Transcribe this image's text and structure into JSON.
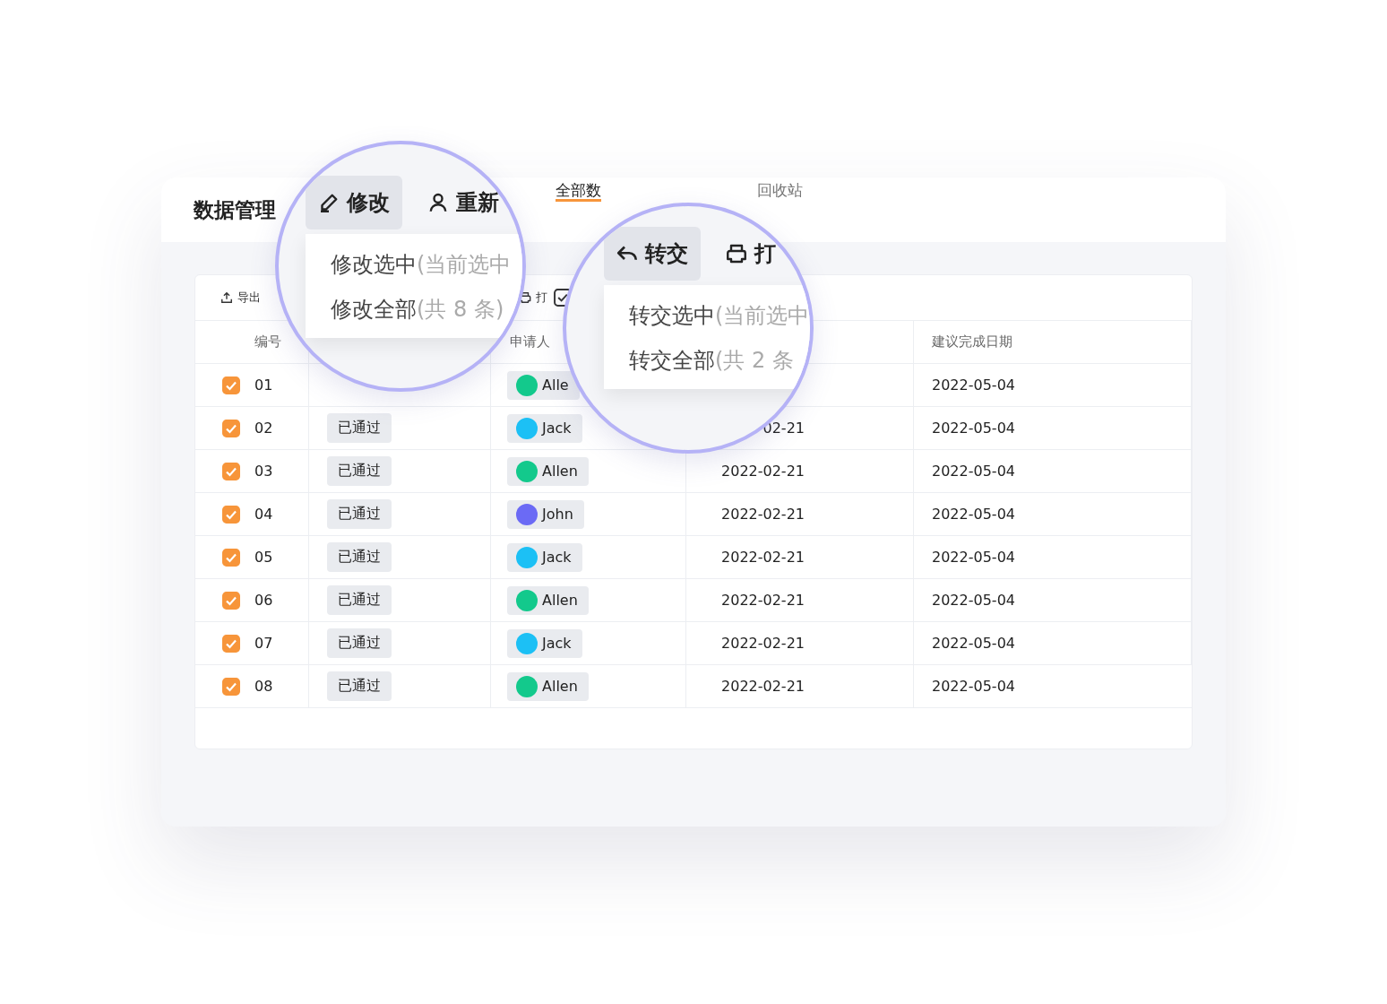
{
  "header": {
    "title": "数据管理",
    "tabs": [
      {
        "label": "全部数",
        "selected": true
      },
      {
        "label": "回收站",
        "selected": false
      }
    ]
  },
  "toolbar": [
    {
      "kind": "export",
      "label": "导出"
    },
    {
      "kind": "print",
      "label": "打"
    },
    {
      "kind": "check"
    }
  ],
  "table": {
    "headers": {
      "id": "编号",
      "applicant": "申请人",
      "due": "建议完成日期"
    },
    "rows": [
      {
        "id": "01",
        "checked": true,
        "applicant": {
          "name": "Alle",
          "color": "#13c98c"
        },
        "due": "2022-05-04"
      },
      {
        "id": "02",
        "checked": true,
        "status": "已通过",
        "applicant": {
          "name": "Jack",
          "color": "#1cc0f5"
        },
        "submitted": "02-21",
        "due": "2022-05-04"
      },
      {
        "id": "03",
        "checked": true,
        "status": "已通过",
        "applicant": {
          "name": "Allen",
          "color": "#13c98c"
        },
        "submitted": "2022-02-21",
        "due": "2022-05-04"
      },
      {
        "id": "04",
        "checked": true,
        "status": "已通过",
        "applicant": {
          "name": "John",
          "color": "#6b6af5"
        },
        "submitted": "2022-02-21",
        "due": "2022-05-04"
      },
      {
        "id": "05",
        "checked": true,
        "status": "已通过",
        "applicant": {
          "name": "Jack",
          "color": "#1cc0f5"
        },
        "submitted": "2022-02-21",
        "due": "2022-05-04"
      },
      {
        "id": "06",
        "checked": true,
        "status": "已通过",
        "applicant": {
          "name": "Allen",
          "color": "#13c98c"
        },
        "submitted": "2022-02-21",
        "due": "2022-05-04"
      },
      {
        "id": "07",
        "checked": true,
        "status": "已通过",
        "applicant": {
          "name": "Jack",
          "color": "#1cc0f5"
        },
        "submitted": "2022-02-21",
        "due": "2022-05-04"
      },
      {
        "id": "08",
        "checked": true,
        "status": "已通过",
        "applicant": {
          "name": "Allen",
          "color": "#13c98c"
        },
        "submitted": "2022-02-21",
        "due": "2022-05-04"
      }
    ]
  },
  "magnifiers": [
    {
      "buttons": [
        {
          "kind": "edit",
          "label": "修改",
          "selected": true
        },
        {
          "kind": "user",
          "label": "重新",
          "selected": false
        }
      ],
      "menu": [
        {
          "label": "修改选中",
          "note": "(当前选中"
        },
        {
          "label": "修改全部",
          "note": "(共 8 条)"
        }
      ]
    },
    {
      "buttons": [
        {
          "kind": "reply",
          "label": "转交",
          "selected": true
        },
        {
          "kind": "print",
          "label": "打",
          "selected": false
        }
      ],
      "menu": [
        {
          "label": "转交选中",
          "note": "(当前选中"
        },
        {
          "label": "转交全部",
          "note": "(共 2 条"
        }
      ]
    }
  ]
}
